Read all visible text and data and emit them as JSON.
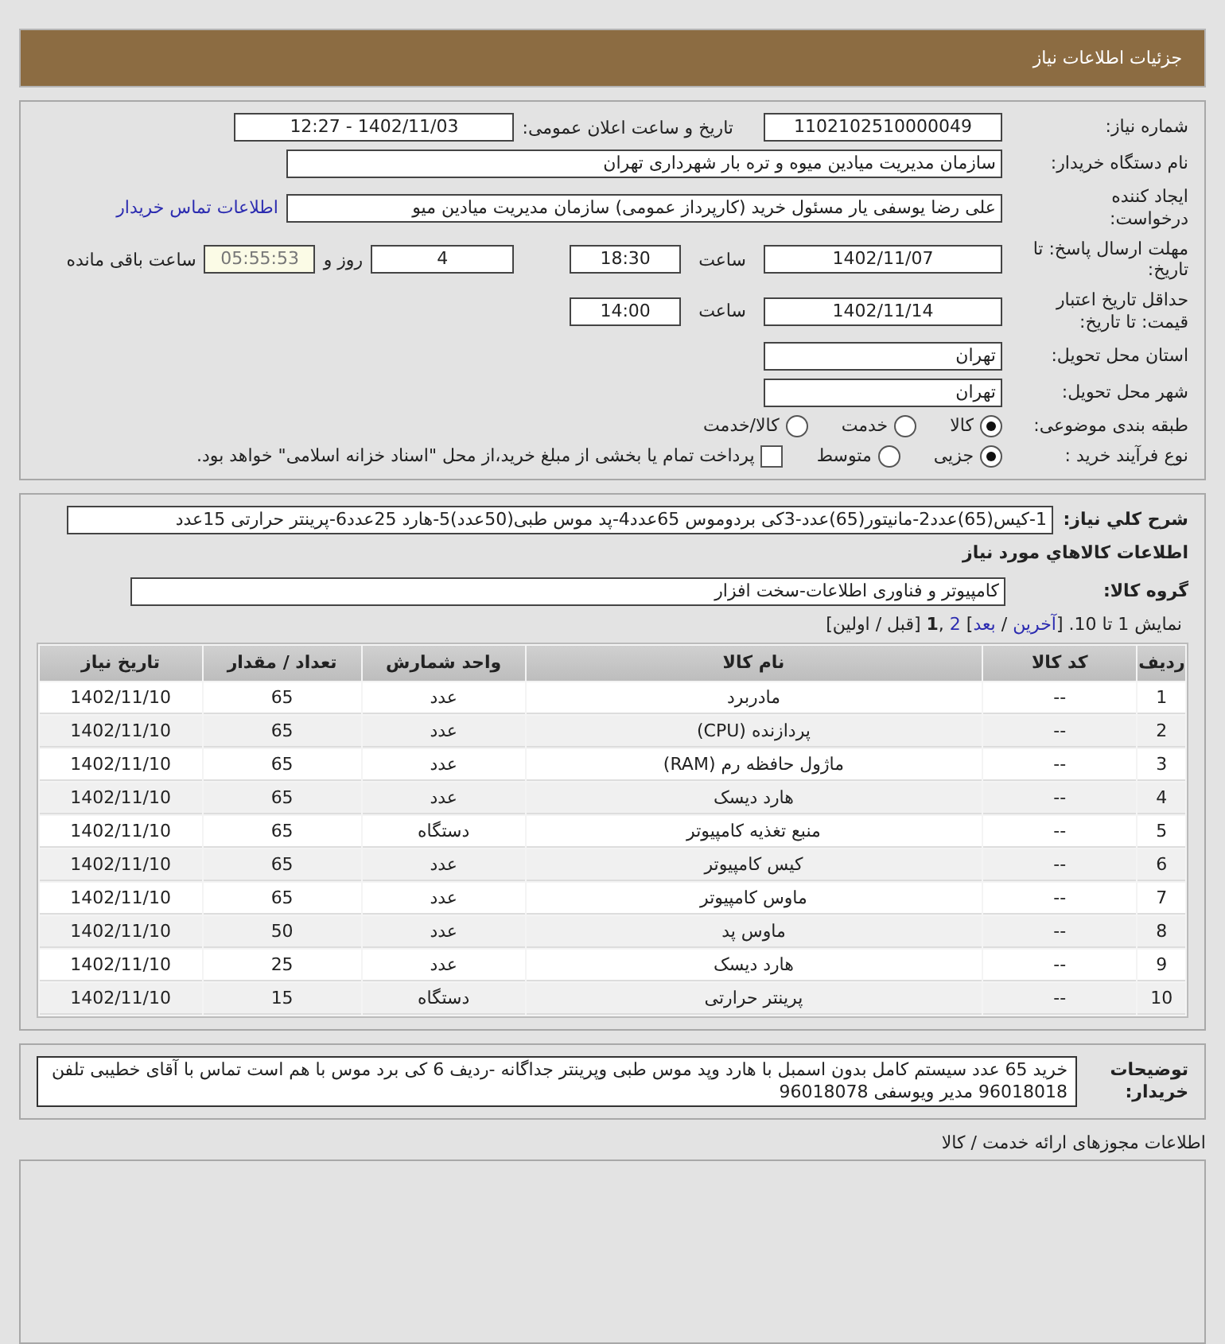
{
  "page_title": "جزئیات اطلاعات نیاز",
  "need_info": {
    "need_number": {
      "label": "شماره نیاز:",
      "value": "1102102510000049"
    },
    "announce": {
      "label": "تاریخ و ساعت اعلان عمومی:",
      "value": "1402/11/03 - 12:27"
    },
    "buyer": {
      "label": "نام دستگاه خریدار:",
      "value": "سازمان مدیریت میادین میوه و تره بار شهرداری تهران"
    },
    "creator": {
      "label": "ایجاد کننده درخواست:",
      "value": "علی رضا یوسفی یار مسئول خرید (کارپرداز عمومی) سازمان مدیریت میادین میو",
      "link": "اطلاعات تماس خریدار"
    },
    "deadline": {
      "label": "مهلت ارسال پاسخ: تا تاریخ:",
      "date": "1402/11/07",
      "time_label": "ساعت",
      "time": "18:30",
      "days": "4",
      "days_label": "روز و",
      "remaining": "05:55:53",
      "remaining_label": "ساعت باقی مانده"
    },
    "validity": {
      "label": "حداقل تاریخ اعتبار قیمت: تا تاریخ:",
      "date": "1402/11/14",
      "time_label": "ساعت",
      "time": "14:00"
    },
    "province": {
      "label": "استان محل تحویل:",
      "value": "تهران"
    },
    "city": {
      "label": "شهر محل تحویل:",
      "value": "تهران"
    },
    "category": {
      "label": "طبقه بندی موضوعی:",
      "options": [
        {
          "label": "کالا",
          "selected": true
        },
        {
          "label": "خدمت",
          "selected": false
        },
        {
          "label": "کالا/خدمت",
          "selected": false
        }
      ]
    },
    "process": {
      "label": "نوع فرآیند خرید :",
      "options": [
        {
          "label": "جزیی",
          "selected": true
        },
        {
          "label": "متوسط",
          "selected": false
        }
      ],
      "payment": {
        "checked": false,
        "label": "پرداخت تمام یا بخشی از مبلغ خرید،از محل \"اسناد خزانه اسلامی\" خواهد بود."
      }
    }
  },
  "goods": {
    "description": {
      "label": "شرح کلي نياز:",
      "value": "1-کیس(65)عدد2-مانیتور(65)عدد-3کی بردوموس 65عدد4-پد موس طبی(50عدد)5-هارد 25عدد6-پرینتر حرارتی 15عدد"
    },
    "section_title": "اطلاعات کالاهاي مورد نياز",
    "group": {
      "label": "گروه کالا:",
      "value": "کامپیوتر و فناوری اطلاعات-سخت افزار"
    },
    "pager": [
      {
        "text": "نمایش 1 تا 10. [",
        "kind": "plain"
      },
      {
        "text": "آخرین",
        "kind": "link"
      },
      {
        "text": " / ",
        "kind": "plain"
      },
      {
        "text": "بعد",
        "kind": "link"
      },
      {
        "text": "] ",
        "kind": "plain"
      },
      {
        "text": "2",
        "kind": "link"
      },
      {
        "text": " ,",
        "kind": "plain"
      },
      {
        "text": "1",
        "kind": "current"
      },
      {
        "text": " [قبل / اولین]",
        "kind": "plain"
      }
    ],
    "table": {
      "columns": [
        "ردیف",
        "کد کالا",
        "نام کالا",
        "واحد شمارش",
        "تعداد / مقدار",
        "تاریخ نیاز"
      ],
      "rows": [
        [
          "1",
          "--",
          "مادربرد",
          "عدد",
          "65",
          "1402/11/10"
        ],
        [
          "2",
          "--",
          "پردازنده (CPU)",
          "عدد",
          "65",
          "1402/11/10"
        ],
        [
          "3",
          "--",
          "ماژول حافظه رم (RAM)",
          "عدد",
          "65",
          "1402/11/10"
        ],
        [
          "4",
          "--",
          "هارد دیسک",
          "عدد",
          "65",
          "1402/11/10"
        ],
        [
          "5",
          "--",
          "منبع تغذیه کامپیوتر",
          "دستگاه",
          "65",
          "1402/11/10"
        ],
        [
          "6",
          "--",
          "کیس کامپیوتر",
          "عدد",
          "65",
          "1402/11/10"
        ],
        [
          "7",
          "--",
          "ماوس کامپیوتر",
          "عدد",
          "65",
          "1402/11/10"
        ],
        [
          "8",
          "--",
          "ماوس پد",
          "عدد",
          "50",
          "1402/11/10"
        ],
        [
          "9",
          "--",
          "هارد دیسک",
          "عدد",
          "25",
          "1402/11/10"
        ],
        [
          "10",
          "--",
          "پرینتر حرارتی",
          "دستگاه",
          "15",
          "1402/11/10"
        ]
      ]
    }
  },
  "buyer_notes": {
    "label": "توضیحات خریدار:",
    "value": "خرید 65 عدد سیستم کامل بدون اسمبل با هارد وپد موس طبی وپرینتر جداگانه -ردیف 6 کی برد موس با هم است تماس با آقای خطیبی تلفن 96018018 مدیر ویوسفی 96018078"
  },
  "licenses_title": "اطلاعات مجوزهای ارائه خدمت / کالا"
}
